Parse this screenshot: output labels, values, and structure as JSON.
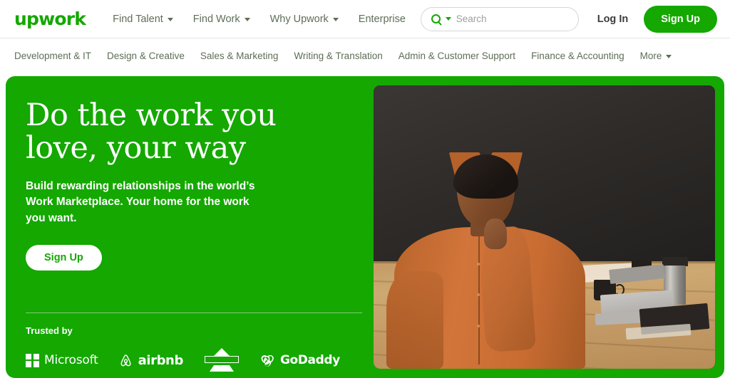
{
  "header": {
    "logo": "upwork",
    "nav": [
      {
        "label": "Find Talent",
        "has_caret": true
      },
      {
        "label": "Find Work",
        "has_caret": true
      },
      {
        "label": "Why Upwork",
        "has_caret": true
      },
      {
        "label": "Enterprise",
        "has_caret": false
      }
    ],
    "search": {
      "placeholder": "Search",
      "value": "",
      "icon": "search-icon",
      "dropdown_icon": "chevron-down-icon"
    },
    "login_label": "Log In",
    "signup_label": "Sign Up"
  },
  "categories": [
    {
      "label": "Development & IT",
      "has_caret": false
    },
    {
      "label": "Design & Creative",
      "has_caret": false
    },
    {
      "label": "Sales & Marketing",
      "has_caret": false
    },
    {
      "label": "Writing & Translation",
      "has_caret": false
    },
    {
      "label": "Admin & Customer Support",
      "has_caret": false
    },
    {
      "label": "Finance & Accounting",
      "has_caret": false
    },
    {
      "label": "More",
      "has_caret": true
    }
  ],
  "hero": {
    "title": "Do the work you\nlove, your way",
    "subtitle": "Build rewarding relationships in the world’s Work Marketplace. Your home for the work you want.",
    "cta_label": "Sign Up",
    "trusted_label": "Trusted by",
    "brands": [
      {
        "name": "Microsoft",
        "label": "Microsoft"
      },
      {
        "name": "airbnb",
        "label": "airbnb"
      },
      {
        "name": "Bissell",
        "label": "Bissell"
      },
      {
        "name": "GoDaddy",
        "label": "GoDaddy"
      }
    ],
    "image_alt": "Woman in orange shirt seated at a wooden desk"
  },
  "colors": {
    "brand_green": "#14a800",
    "nav_text": "#5e6e57",
    "white": "#ffffff",
    "border": "#e4e4e4",
    "placeholder": "#9aa09a"
  }
}
